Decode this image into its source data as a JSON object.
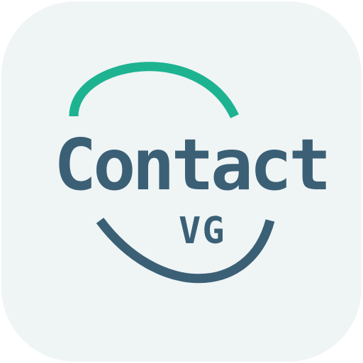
{
  "logo": {
    "title": "Contact",
    "subtitle": "VG"
  },
  "colors": {
    "tile_background": "#eff4f5",
    "text_primary": "#3b6076",
    "arc_top": "#1db391",
    "arc_bottom": "#3b6076"
  },
  "icons": {
    "top_arc": "teal-arc-icon",
    "bottom_arc": "navy-arc-icon"
  }
}
